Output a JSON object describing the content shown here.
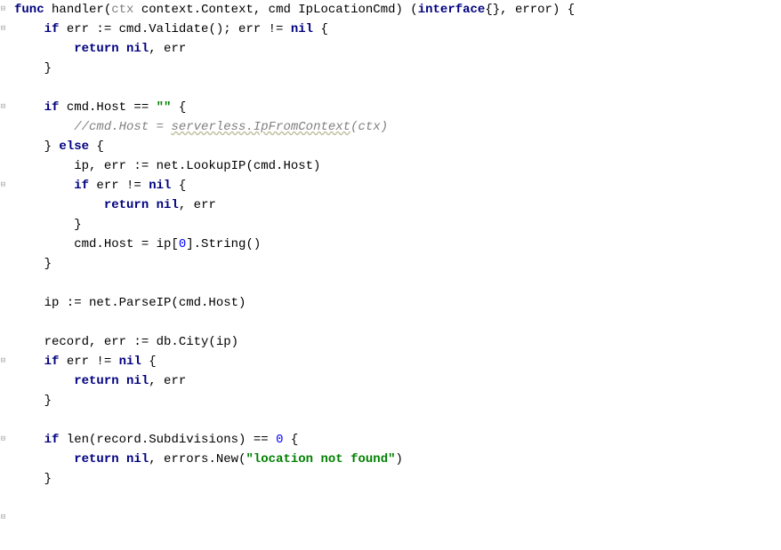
{
  "code": {
    "l1_func": "func",
    "l1_name": " handler(",
    "l1_ctx": "ctx",
    "l1_sigrest": " context.Context, cmd IpLocationCmd) (",
    "l1_interface": "interface",
    "l1_tail": "{}, error) {",
    "l2_if": "    if",
    "l2_body": " err := cmd.Validate(); err != ",
    "l2_nil": "nil",
    "l2_brace": " {",
    "l3_return": "        return ",
    "l3_nil": "nil",
    "l3_err": ", err",
    "l4_brace": "    }",
    "l5_blank": "",
    "l6_if": "    if",
    "l6_body": " cmd.Host == ",
    "l6_str": "\"\"",
    "l6_brace": " {",
    "l7_comment": "        //cmd.Host = ",
    "l7_wavy": "serverless.IpFromContext",
    "l7_comment_end": "(ctx)",
    "l8_else": "    } else {",
    "l8_else_kw": "else",
    "l8_pre": "    } ",
    "l8_post": " {",
    "l9_body": "        ip, err := net.LookupIP(cmd.Host)",
    "l10_if": "        if",
    "l10_body": " err != ",
    "l10_nil": "nil",
    "l10_brace": " {",
    "l11_return": "            return ",
    "l11_nil": "nil",
    "l11_err": ", err",
    "l12_brace": "        }",
    "l13_pre": "        cmd.Host = ip[",
    "l13_num": "0",
    "l13_post": "].String()",
    "l14_brace": "    }",
    "l15_blank": "",
    "l16_body": "    ip := net.ParseIP(cmd.Host)",
    "l17_blank": "",
    "l18_body": "    record, err := db.City(ip)",
    "l19_if": "    if",
    "l19_body": " err != ",
    "l19_nil": "nil",
    "l19_brace": " {",
    "l20_return": "        return ",
    "l20_nil": "nil",
    "l20_err": ", err",
    "l21_brace": "    }",
    "l22_blank": "",
    "l23_if": "    if",
    "l23_body": " len(record.Subdivisions) == ",
    "l23_num": "0",
    "l23_brace": " {",
    "l24_return": "        return ",
    "l24_nil": "nil",
    "l24_mid": ", errors.New(",
    "l24_str": "\"location not found\"",
    "l24_end": ")",
    "l25_brace": "    }"
  },
  "fold_glyph": "⊟"
}
